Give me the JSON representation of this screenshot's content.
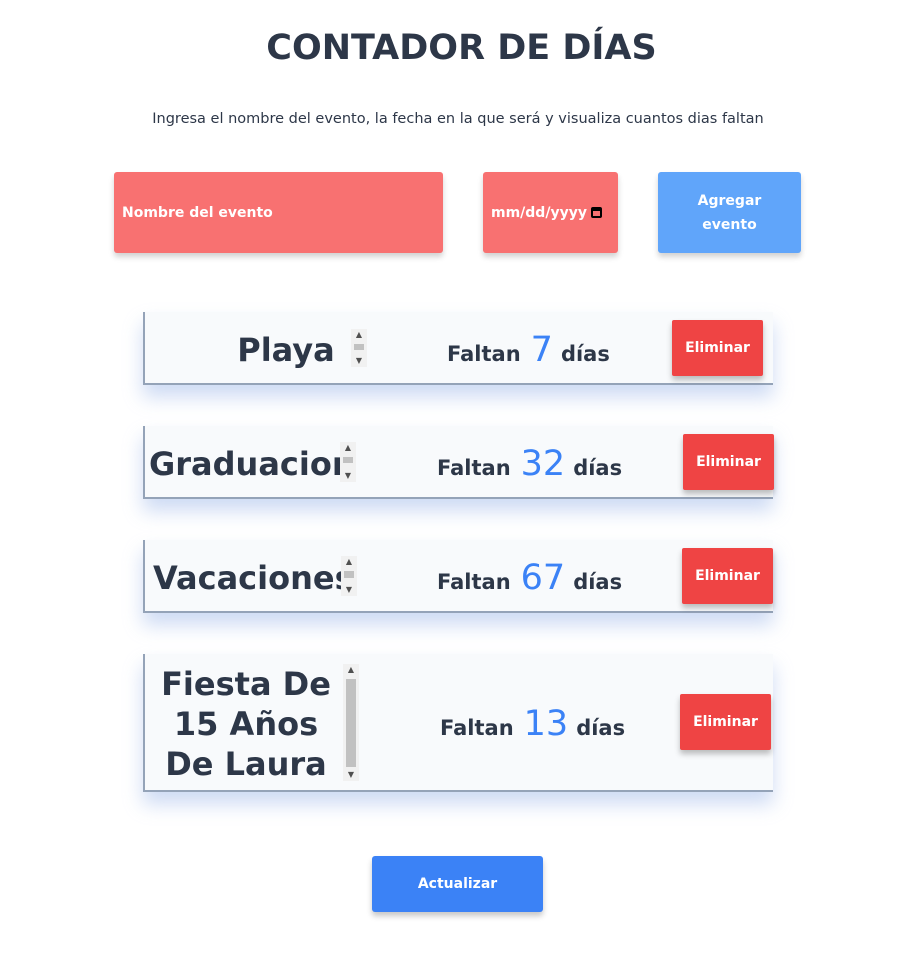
{
  "header": {
    "title": "CONTADOR DE DÍAS",
    "subtitle": "Ingresa el nombre del evento, la fecha en la que será y visualiza cuantos dias faltan"
  },
  "form": {
    "name_placeholder": "Nombre del evento",
    "date_placeholder": "mm/dd/yyyy",
    "add_button_label": "Agregar evento"
  },
  "events": [
    {
      "name": "Playa",
      "faltan_label": "Faltan",
      "days": "7",
      "dias_label": "días",
      "delete_label": "Eliminar"
    },
    {
      "name": "Graduacion",
      "faltan_label": "Faltan",
      "days": "32",
      "dias_label": "días",
      "delete_label": "Eliminar"
    },
    {
      "name": "Vacaciones",
      "faltan_label": "Faltan",
      "days": "67",
      "dias_label": "días",
      "delete_label": "Eliminar"
    },
    {
      "name": "Fiesta De 15 Años De Laura",
      "faltan_label": "Faltan",
      "days": "13",
      "dias_label": "días",
      "delete_label": "Eliminar"
    }
  ],
  "update_button_label": "Actualizar",
  "colors": {
    "input_bg": "#f87171",
    "add_button": "#60a5fa",
    "delete_button": "#ef4444",
    "update_button": "#3b82f6",
    "days_number": "#3b82f6"
  }
}
